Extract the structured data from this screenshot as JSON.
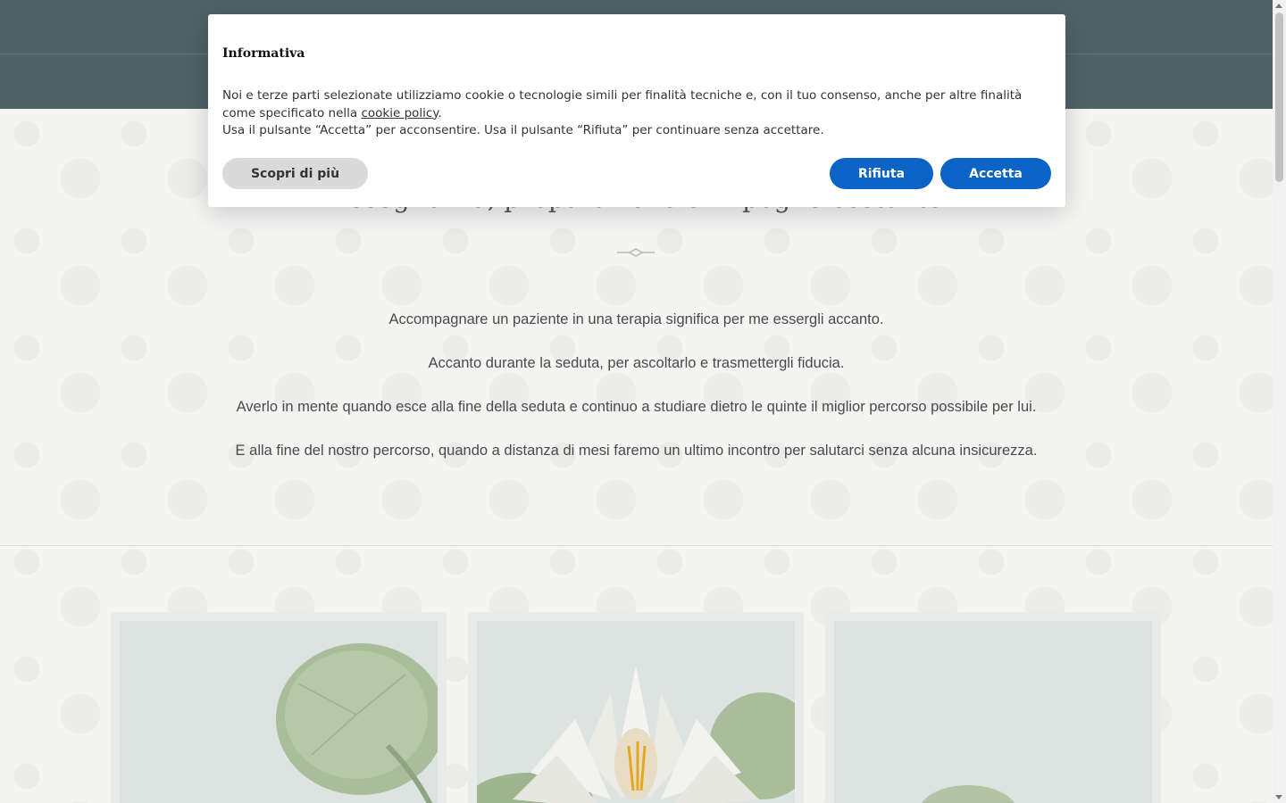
{
  "header": {},
  "main": {
    "headline": "Accoglienza, preparazione e impegno costante",
    "paragraphs": [
      "Accompagnare un paziente in una terapia significa per me essergli accanto.",
      "Accanto durante la seduta, per ascoltarlo e trasmettergli fiducia.",
      "Averlo in mente quando esce alla fine della seduta e continuo a studiare dietro le quinte il miglior percorso possibile per lui.",
      "E alla fine del nostro percorso, quando a distanza di mesi faremo un ultimo incontro per salutarci senza alcuna insicurezza."
    ]
  },
  "cards": [
    {
      "icon": "lily-pad-icon"
    },
    {
      "icon": "water-lily-icon"
    },
    {
      "icon": "lily-pad-icon"
    }
  ],
  "cookie_banner": {
    "title": "Informativa",
    "text_part1": "Noi e terze parti selezionate utilizziamo cookie o tecnologie simili per finalità tecniche e, con il tuo consenso, anche per altre finalità come specificato nella ",
    "link_text": "cookie policy",
    "text_part2": ".",
    "text_line2": "Usa il pulsante “Accetta” per acconsentire. Usa il pulsante “Rifiuta” per continuare senza accettare.",
    "more_label": "Scopri di più",
    "reject_label": "Rifiuta",
    "accept_label": "Accetta"
  },
  "colors": {
    "header_bg": "#4f6266",
    "primary_button": "#0b63c6",
    "secondary_button": "#dadada"
  }
}
